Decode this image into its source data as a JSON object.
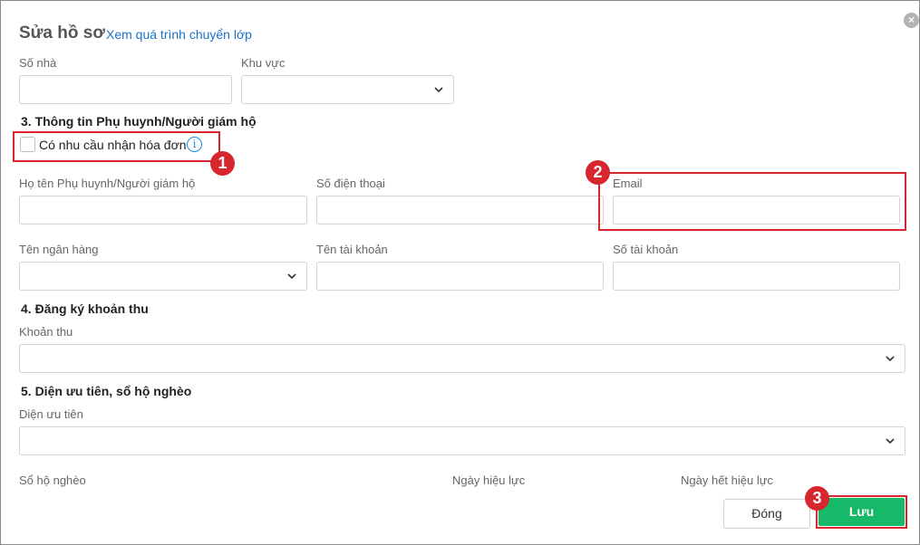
{
  "header": {
    "title": "Sửa hồ sơ",
    "link": "Xem quá trình chuyển lớp",
    "close_glyph": "×"
  },
  "address": {
    "house_label": "Số nhà",
    "area_label": "Khu vực"
  },
  "guardian": {
    "section_title": "3. Thông tin Phụ huynh/Người giám hộ",
    "invoice_label": "Có nhu cầu nhận hóa đơn",
    "info_glyph": "i",
    "name_label": "Họ tên Phụ huynh/Người giám hộ",
    "phone_label": "Số điện thoại",
    "email_label": "Email",
    "bank_label": "Tên ngân hàng",
    "account_name_label": "Tên tài khoản",
    "account_number_label": "Số tài khoản"
  },
  "fees": {
    "section_title": "4. Đăng ký khoản thu",
    "fee_label": "Khoản thu"
  },
  "priority": {
    "section_title": "5. Diện ưu tiên, sổ hộ nghèo",
    "priority_label": "Diện ưu tiên",
    "poor_book_label": "Sổ hộ nghèo",
    "effective_date_label": "Ngày hiệu lực",
    "expiry_date_label": "Ngày hết hiệu lực"
  },
  "footer": {
    "close_label": "Đóng",
    "save_label": "Lưu"
  },
  "annotations": {
    "step1": "1",
    "step2": "2",
    "step3": "3",
    "color": "#d6262e"
  },
  "colors": {
    "save_button": "#17b867",
    "link": "#1a73c8"
  }
}
